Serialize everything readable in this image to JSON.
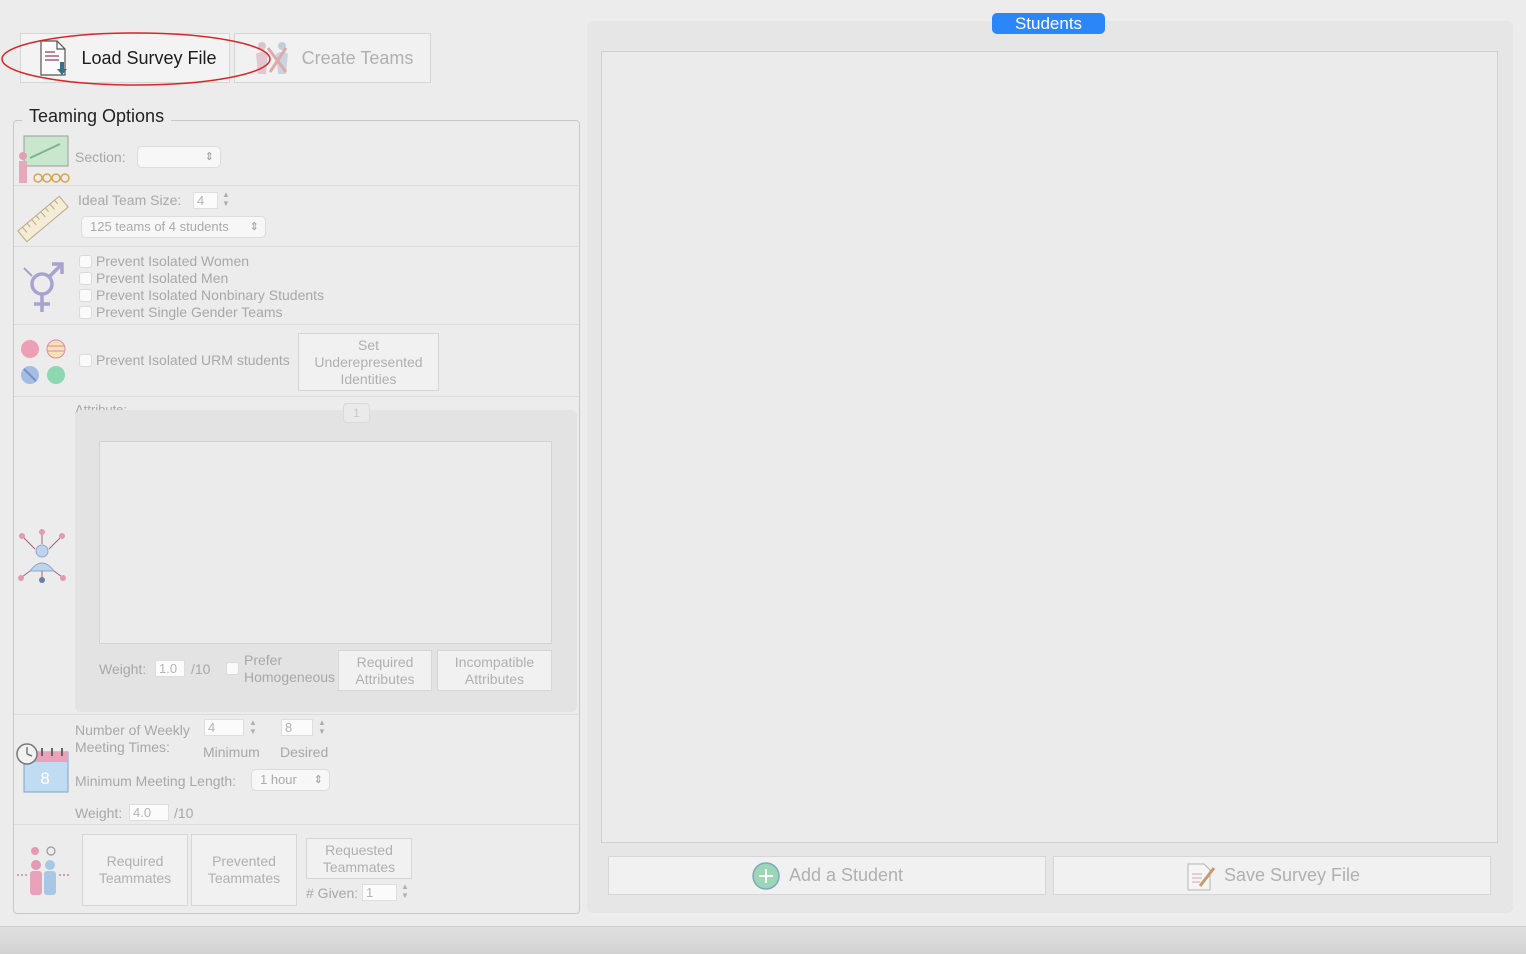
{
  "toolbar": {
    "load_survey_label": "Load Survey File",
    "create_teams_label": "Create Teams"
  },
  "teaming_options": {
    "title": "Teaming Options",
    "section_label": "Section:",
    "section_value": "",
    "ideal_team_size_label": "Ideal Team Size:",
    "ideal_team_size_value": "4",
    "team_breakdown": "125 teams of 4 students",
    "gender": {
      "prevent_isolated_women": "Prevent Isolated Women",
      "prevent_isolated_men": "Prevent Isolated Men",
      "prevent_isolated_nonbinary": "Prevent Isolated Nonbinary Students",
      "prevent_single_gender": "Prevent Single Gender Teams"
    },
    "urm": {
      "prevent_isolated_urm": "Prevent Isolated URM students",
      "set_underrepresented_label": "Set Underepresented Identities"
    },
    "attribute": {
      "label": "Attribute:",
      "tab_label": "1",
      "weight_label": "Weight:",
      "weight_value": "1.0",
      "weight_max": "/10",
      "prefer_homogeneous": "Prefer Homogeneous",
      "required_attributes": "Required Attributes",
      "incompatible_attributes": "Incompatible Attributes"
    },
    "schedule": {
      "weekly_meetings_label": "Number of Weekly Meeting Times:",
      "minimum_value": "4",
      "desired_value": "8",
      "minimum_caption": "Minimum",
      "desired_caption": "Desired",
      "meeting_length_label": "Minimum Meeting Length:",
      "meeting_length_value": "1 hour",
      "weight_label": "Weight:",
      "weight_value": "4.0",
      "weight_max": "/10"
    },
    "teammates": {
      "required_teammates": "Required Teammates",
      "prevented_teammates": "Prevented Teammates",
      "requested_teammates": "Requested Teammates",
      "given_label": "# Given:",
      "given_value": "1"
    }
  },
  "students": {
    "tab_label": "Students",
    "add_student_label": "Add a Student",
    "save_survey_label": "Save Survey File"
  },
  "colors": {
    "accent": "#2b86f7",
    "highlight_ring": "#d62828"
  },
  "icons": [
    "load-file-icon",
    "create-teams-icon",
    "section-teacher-icon",
    "ruler-icon",
    "gender-icon",
    "urm-identities-icon",
    "attribute-network-icon",
    "calendar-clock-icon",
    "teammates-icon",
    "add-circle-icon",
    "save-file-icon"
  ]
}
